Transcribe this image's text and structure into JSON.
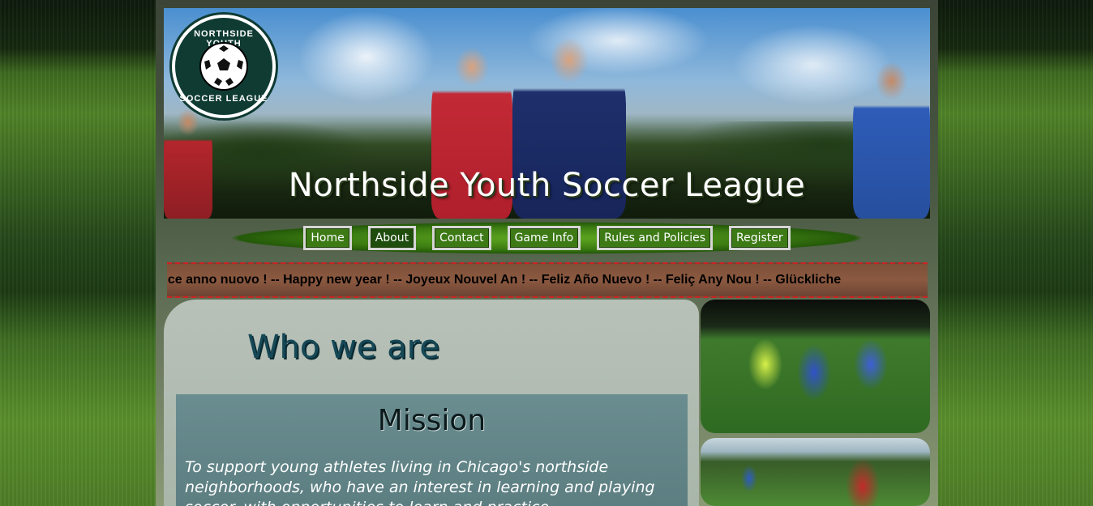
{
  "header": {
    "title": "Northside Youth Soccer League",
    "logo_top": "NORTHSIDE YOUTH",
    "logo_bottom": "SOCCER LEAGUE"
  },
  "nav": {
    "items": [
      {
        "label": "Home"
      },
      {
        "label": "About"
      },
      {
        "label": "Contact"
      },
      {
        "label": "Game Info"
      },
      {
        "label": "Rules and Policies"
      },
      {
        "label": "Register"
      }
    ],
    "active": "About"
  },
  "ticker": {
    "text": "lice anno nuovo ! -- Happy new year ! -- Joyeux Nouvel An ! -- Feliz Año Nuevo ! -- Feliç Any Nou ! -- Glückliche"
  },
  "main": {
    "heading": "Who we are",
    "mission_title": "Mission",
    "mission_text": "To support young athletes living in Chicago's northside neighborhoods, who have an interest in learning and playing soccer, with opportunities to learn and practice"
  },
  "colors": {
    "nav_green": "#3d7a16",
    "heading_teal": "#164856",
    "ticker_border": "#cc2222"
  }
}
